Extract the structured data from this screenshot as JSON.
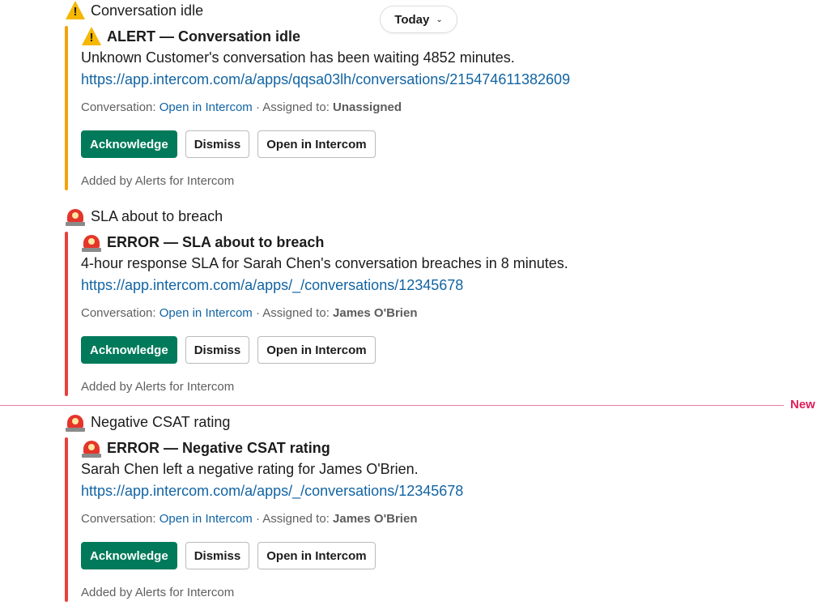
{
  "date_pill": {
    "label": "Today",
    "chevron": "chevron-down-icon"
  },
  "new_divider": {
    "label": "New"
  },
  "colors": {
    "warning_bar": "#f2a20c",
    "error_bar": "#e8413c",
    "primary_button": "#007a5a",
    "link": "#1264a3",
    "new_divider": "#e01e5a"
  },
  "messages": [
    {
      "header": "Conversation idle",
      "icon": "warning-icon",
      "severity": "warning",
      "attachment": {
        "title": "ALERT — Conversation idle",
        "body": "Unknown Customer's conversation has been waiting 4852 minutes.",
        "link": "https://app.intercom.com/a/apps/qqsa03lh/conversations/215474611382609",
        "context_prefix": "Conversation:",
        "context_link": "Open in Intercom",
        "context_sep": "· Assigned to:",
        "assignee": "Unassigned",
        "buttons": {
          "acknowledge": "Acknowledge",
          "dismiss": "Dismiss",
          "open": "Open in Intercom"
        },
        "footer": "Added by Alerts for Intercom"
      }
    },
    {
      "header": "SLA about to breach",
      "icon": "siren-icon",
      "severity": "error",
      "attachment": {
        "title": "ERROR — SLA about to breach",
        "body": "4-hour response SLA for Sarah Chen's conversation breaches in 8 minutes.",
        "link": "https://app.intercom.com/a/apps/_/conversations/12345678",
        "context_prefix": "Conversation:",
        "context_link": "Open in Intercom",
        "context_sep": "· Assigned to:",
        "assignee": "James O'Brien",
        "buttons": {
          "acknowledge": "Acknowledge",
          "dismiss": "Dismiss",
          "open": "Open in Intercom"
        },
        "footer": "Added by Alerts for Intercom"
      }
    },
    {
      "header": "Negative CSAT rating",
      "icon": "siren-icon",
      "severity": "error",
      "attachment": {
        "title": "ERROR — Negative CSAT rating",
        "body": "Sarah Chen left a negative rating for James O'Brien.",
        "link": "https://app.intercom.com/a/apps/_/conversations/12345678",
        "context_prefix": "Conversation:",
        "context_link": "Open in Intercom",
        "context_sep": "· Assigned to:",
        "assignee": "James O'Brien",
        "buttons": {
          "acknowledge": "Acknowledge",
          "dismiss": "Dismiss",
          "open": "Open in Intercom"
        },
        "footer": "Added by Alerts for Intercom"
      }
    }
  ]
}
